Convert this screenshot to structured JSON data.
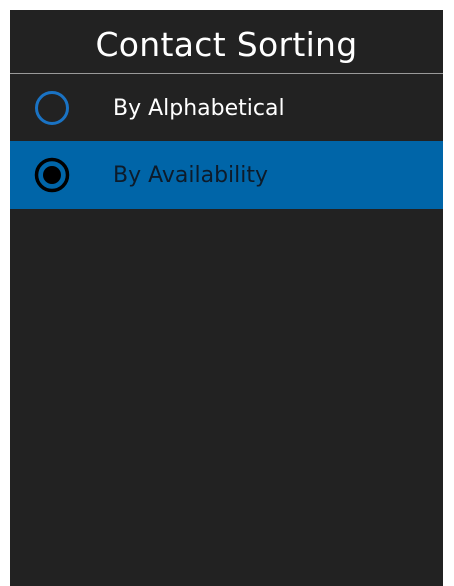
{
  "header": {
    "title": "Contact Sorting"
  },
  "options": [
    {
      "label": "By Alphabetical",
      "selected": false
    },
    {
      "label": "By Availability",
      "selected": true
    }
  ],
  "colors": {
    "background": "#222222",
    "highlight": "#0065a8",
    "radio_unselected": "#1a73c4",
    "radio_selected": "#000000",
    "divider": "#9a9a9a"
  },
  "icons": {
    "unselected": "radio-unselected-icon",
    "selected": "radio-selected-icon"
  }
}
